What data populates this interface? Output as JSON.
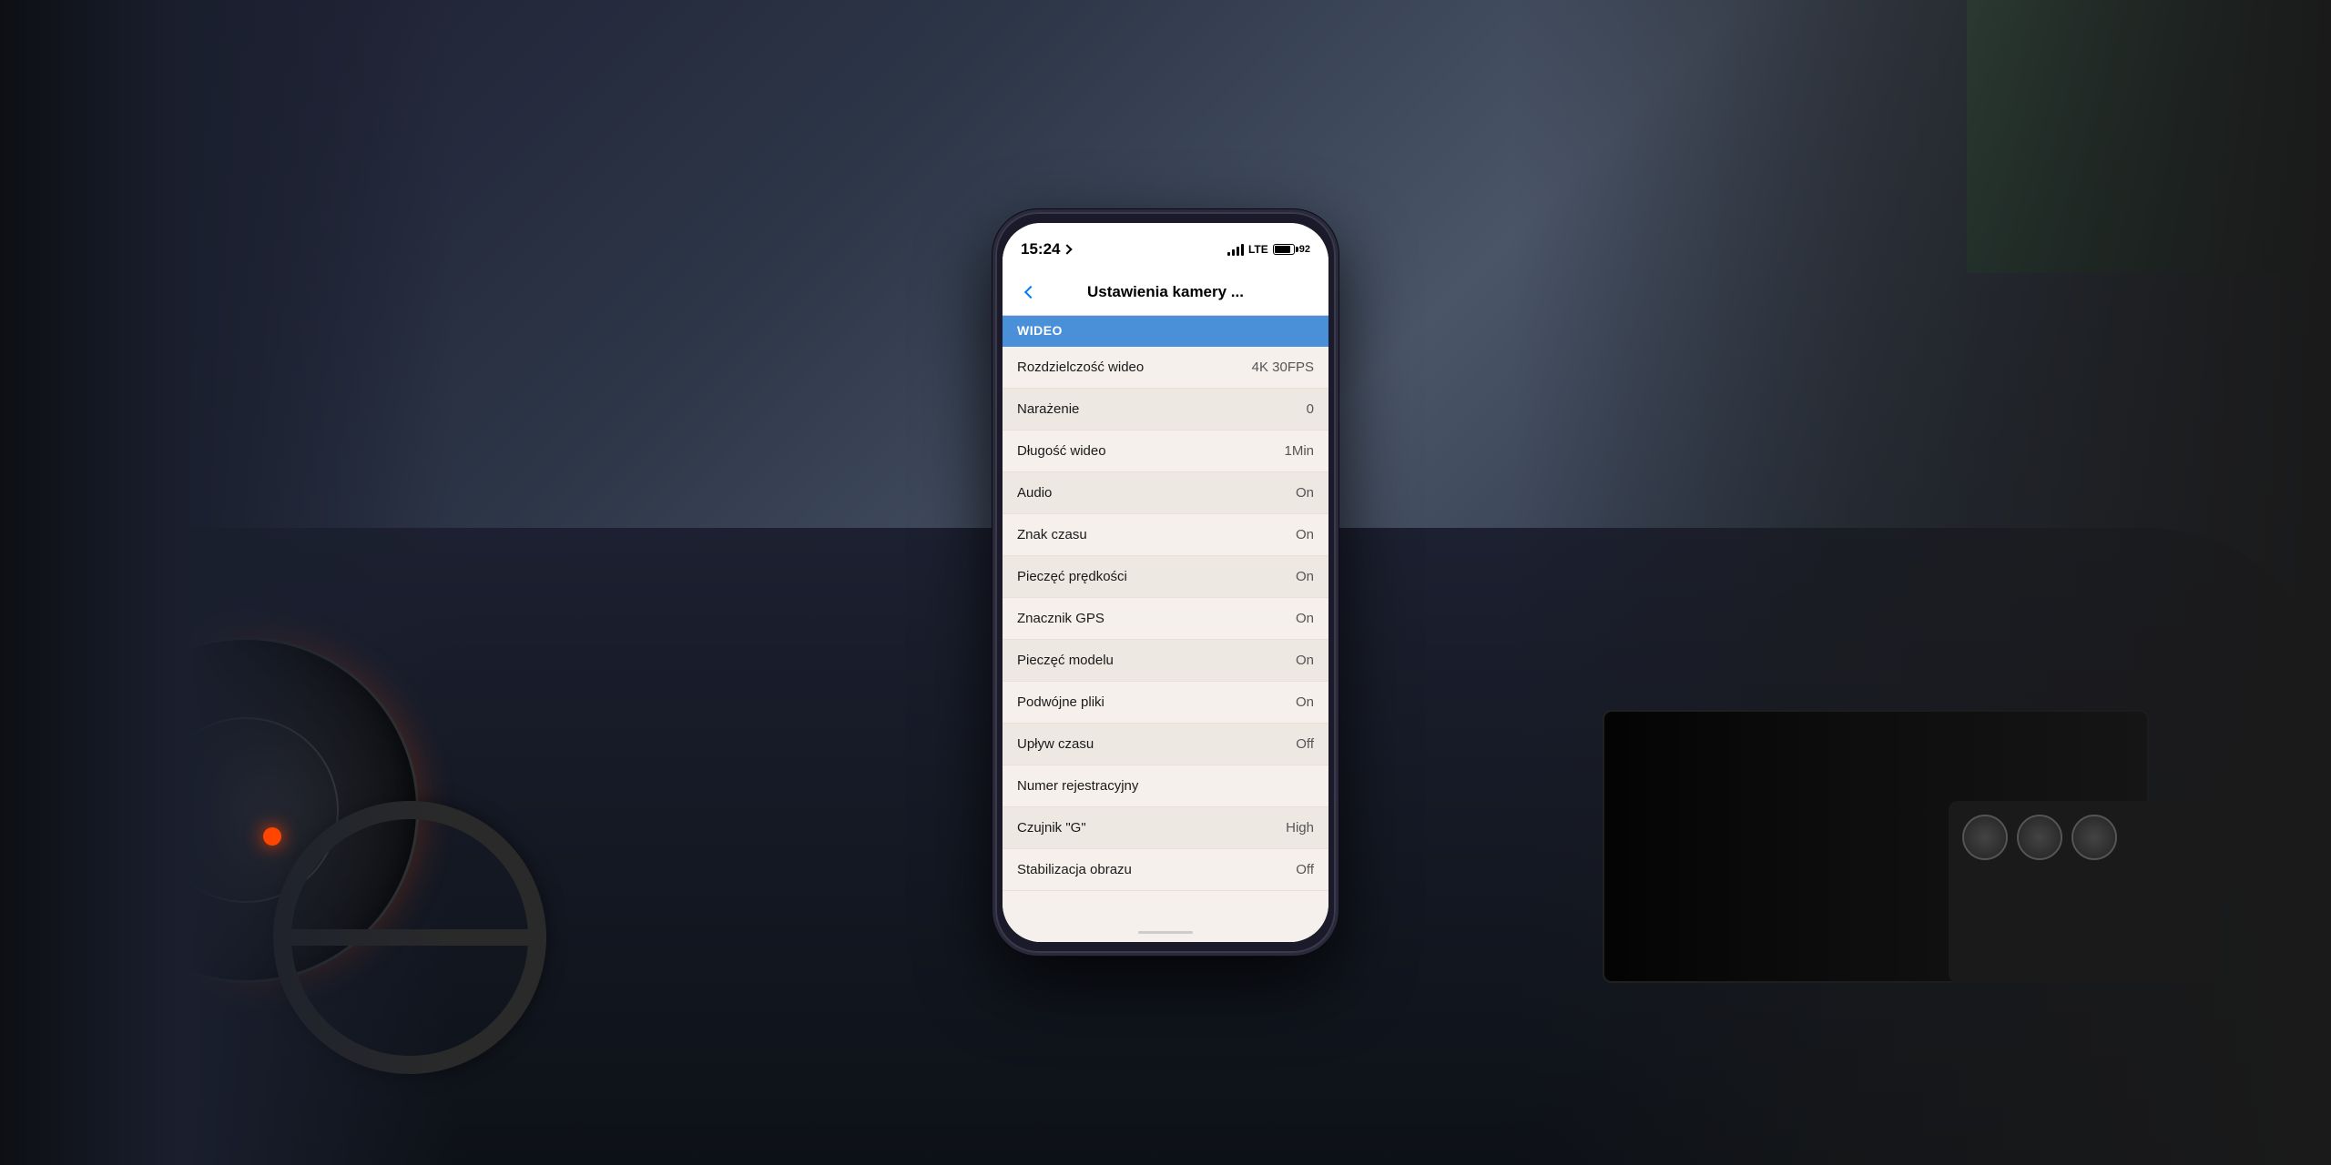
{
  "scene": {
    "background_description": "Car interior with dashboard, steering wheel, and center console"
  },
  "phone": {
    "status_bar": {
      "time": "15:24",
      "location_icon": "→",
      "signal": "●●●",
      "network": "LTE",
      "battery_level": 92
    },
    "nav": {
      "back_label": "‹",
      "title": "Ustawienia kamery ..."
    },
    "section": {
      "header": "WIDEO"
    },
    "settings": [
      {
        "label": "Rozdzielczość wideo",
        "value": "4K 30FPS"
      },
      {
        "label": "Narażenie",
        "value": "0"
      },
      {
        "label": "Długość wideo",
        "value": "1Min"
      },
      {
        "label": "Audio",
        "value": "On"
      },
      {
        "label": "Znak czasu",
        "value": "On"
      },
      {
        "label": "Pieczęć prędkości",
        "value": "On"
      },
      {
        "label": "Znacznik GPS",
        "value": "On"
      },
      {
        "label": "Pieczęć modelu",
        "value": "On"
      },
      {
        "label": "Podwójne pliki",
        "value": "On"
      },
      {
        "label": "Upływ czasu",
        "value": "Off"
      },
      {
        "label": "Numer rejestracyjny",
        "value": ""
      },
      {
        "label": "Czujnik \"G\"",
        "value": "High"
      },
      {
        "label": "Stabilizacja obrazu",
        "value": "Off"
      }
    ],
    "colors": {
      "section_header_bg": "#4a90d9",
      "screen_bg": "#f5f0eb",
      "phone_body": "#1a1a2a"
    }
  }
}
